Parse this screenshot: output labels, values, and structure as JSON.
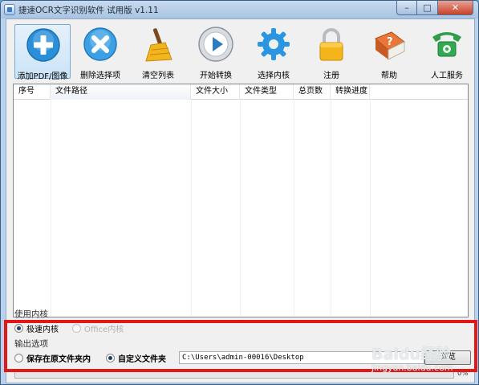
{
  "window": {
    "title": "捷速OCR文字识别软件 试用版 v1.11",
    "controls": {
      "minimize": "–",
      "maximize": "□",
      "close": "✕"
    }
  },
  "toolbar": {
    "items": [
      {
        "label": "添加PDF/图像",
        "icon": "add-icon"
      },
      {
        "label": "删除选择项",
        "icon": "delete-icon"
      },
      {
        "label": "清空列表",
        "icon": "broom-icon"
      },
      {
        "label": "开始转换",
        "icon": "play-icon"
      },
      {
        "label": "选择内核",
        "icon": "gear-icon"
      },
      {
        "label": "注册",
        "icon": "lock-icon"
      },
      {
        "label": "帮助",
        "icon": "help-book-icon"
      },
      {
        "label": "人工服务",
        "icon": "phone-icon"
      }
    ]
  },
  "table": {
    "columns": [
      "序号",
      "文件路径",
      "文件大小",
      "文件类型",
      "总页数",
      "转换进度"
    ],
    "rows": []
  },
  "engine": {
    "section_label": "使用内核",
    "options": [
      {
        "label": "极速内核",
        "checked": true,
        "enabled": true
      },
      {
        "label": "Office内核",
        "checked": false,
        "enabled": false
      }
    ]
  },
  "output": {
    "section_label": "输出选项",
    "options": [
      {
        "label": "保存在原文件夹内",
        "checked": false
      },
      {
        "label": "自定义文件夹",
        "checked": true
      }
    ],
    "path": "C:\\Users\\admin-00016\\Desktop",
    "browse_label": "浏览"
  },
  "progress": {
    "value": 0,
    "text": "0%"
  },
  "watermark": {
    "brand": "Baidu经验",
    "url": "jingyan.baidu.com"
  },
  "colors": {
    "highlight": "#e01818",
    "titlebar": "#b9d1ea",
    "accent": "#2a8fd8"
  }
}
